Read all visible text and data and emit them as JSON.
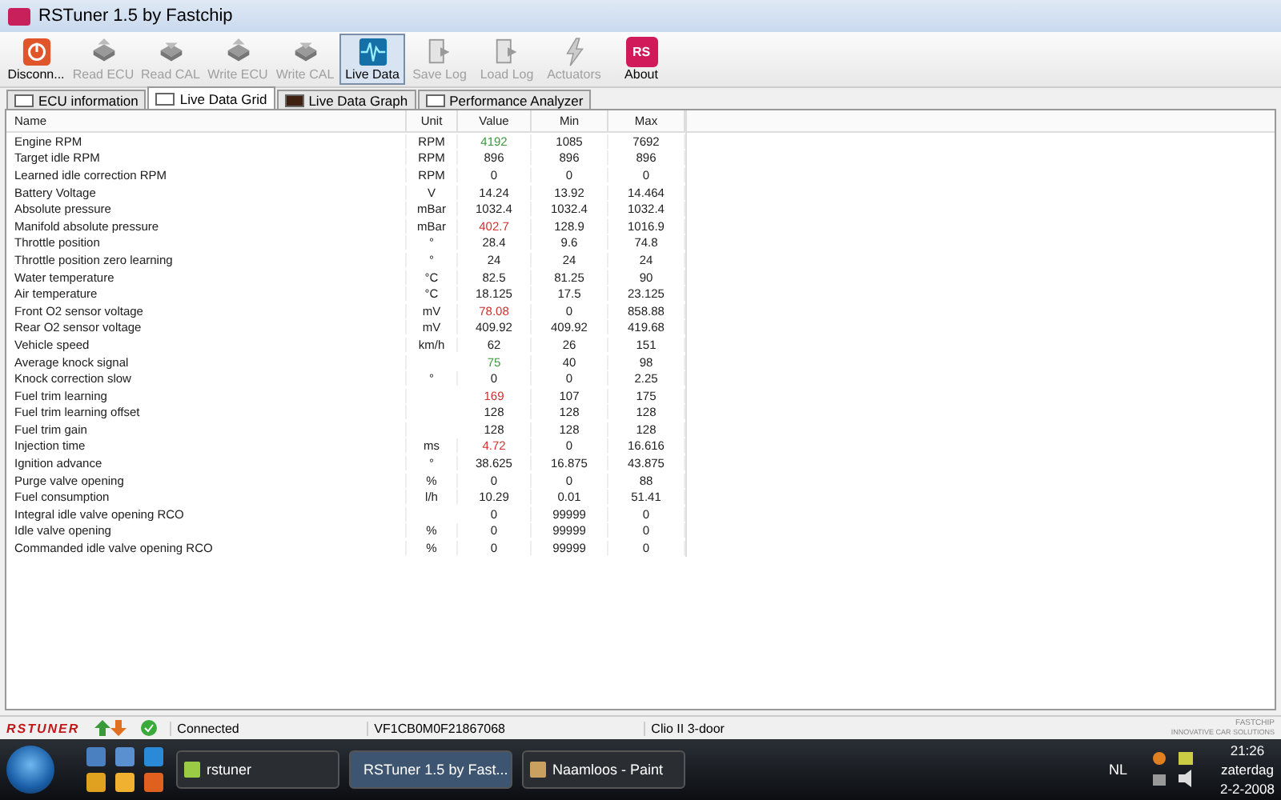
{
  "window": {
    "title": "RSTuner 1.5 by Fastchip"
  },
  "toolbar": [
    {
      "label": "Disconn...",
      "kind": "power",
      "disabled": false,
      "selected": false
    },
    {
      "label": "Read ECU",
      "kind": "chip",
      "disabled": true,
      "selected": false
    },
    {
      "label": "Read CAL",
      "kind": "chip",
      "disabled": true,
      "selected": false
    },
    {
      "label": "Write ECU",
      "kind": "chip",
      "disabled": true,
      "selected": false
    },
    {
      "label": "Write CAL",
      "kind": "chip",
      "disabled": true,
      "selected": false
    },
    {
      "label": "Live Data",
      "kind": "wave",
      "disabled": false,
      "selected": true
    },
    {
      "label": "Save Log",
      "kind": "file",
      "disabled": true,
      "selected": false
    },
    {
      "label": "Load Log",
      "kind": "file",
      "disabled": true,
      "selected": false
    },
    {
      "label": "Actuators",
      "kind": "bolt",
      "disabled": true,
      "selected": false
    },
    {
      "label": "About",
      "kind": "logo",
      "logo": "RS",
      "disabled": false,
      "selected": false
    }
  ],
  "tabs": [
    {
      "label": "ECU information",
      "selected": false
    },
    {
      "label": "Live Data Grid",
      "selected": true
    },
    {
      "label": "Live Data Graph",
      "selected": false
    },
    {
      "label": "Performance Analyzer",
      "selected": false
    }
  ],
  "grid": {
    "columns": [
      "Name",
      "Unit",
      "Value",
      "Min",
      "Max"
    ],
    "rows": [
      {
        "name": "Engine RPM",
        "unit": "RPM",
        "value": "4192",
        "min": "1085",
        "max": "7692",
        "color": "#3a9a3a"
      },
      {
        "name": "Target idle RPM",
        "unit": "RPM",
        "value": "896",
        "min": "896",
        "max": "896",
        "color": "#202020"
      },
      {
        "name": "Learned idle correction RPM",
        "unit": "RPM",
        "value": "0",
        "min": "0",
        "max": "0",
        "color": "#202020"
      },
      {
        "name": "Battery Voltage",
        "unit": "V",
        "value": "14.24",
        "min": "13.92",
        "max": "14.464",
        "color": "#202020"
      },
      {
        "name": "Absolute pressure",
        "unit": "mBar",
        "value": "1032.4",
        "min": "1032.4",
        "max": "1032.4",
        "color": "#202020"
      },
      {
        "name": "Manifold absolute pressure",
        "unit": "mBar",
        "value": "402.7",
        "min": "128.9",
        "max": "1016.9",
        "color": "#d03030"
      },
      {
        "name": "Throttle position",
        "unit": "°",
        "value": "28.4",
        "min": "9.6",
        "max": "74.8",
        "color": "#202020"
      },
      {
        "name": "Throttle position zero learning",
        "unit": "°",
        "value": "24",
        "min": "24",
        "max": "24",
        "color": "#202020"
      },
      {
        "name": "Water temperature",
        "unit": "°C",
        "value": "82.5",
        "min": "81.25",
        "max": "90",
        "color": "#202020"
      },
      {
        "name": "Air temperature",
        "unit": "°C",
        "value": "18.125",
        "min": "17.5",
        "max": "23.125",
        "color": "#202020"
      },
      {
        "name": "Front O2 sensor voltage",
        "unit": "mV",
        "value": "78.08",
        "min": "0",
        "max": "858.88",
        "color": "#d03030"
      },
      {
        "name": "Rear O2 sensor voltage",
        "unit": "mV",
        "value": "409.92",
        "min": "409.92",
        "max": "419.68",
        "color": "#202020"
      },
      {
        "name": "Vehicle speed",
        "unit": "km/h",
        "value": "62",
        "min": "26",
        "max": "151",
        "color": "#202020"
      },
      {
        "name": "Average knock signal",
        "value": "75",
        "min": "40",
        "max": "98",
        "color": "#3a9a3a"
      },
      {
        "name": "Knock correction slow",
        "unit": "°",
        "value": "0",
        "min": "0",
        "max": "2.25",
        "color": "#202020"
      },
      {
        "name": "Fuel trim learning",
        "value": "169",
        "min": "107",
        "max": "175",
        "color": "#d03030"
      },
      {
        "name": "Fuel trim learning offset",
        "value": "128",
        "min": "128",
        "max": "128",
        "color": "#202020"
      },
      {
        "name": "Fuel trim gain",
        "value": "128",
        "min": "128",
        "max": "128",
        "color": "#202020"
      },
      {
        "name": "Injection time",
        "unit": "ms",
        "value": "4.72",
        "min": "0",
        "max": "16.616",
        "color": "#d03030"
      },
      {
        "name": "Ignition advance",
        "unit": "°",
        "value": "38.625",
        "min": "16.875",
        "max": "43.875",
        "color": "#202020"
      },
      {
        "name": "Purge valve opening",
        "unit": "%",
        "value": "0",
        "min": "0",
        "max": "88",
        "color": "#202020"
      },
      {
        "name": "Fuel consumption",
        "unit": "l/h",
        "value": "10.29",
        "min": "0.01",
        "max": "51.41",
        "color": "#202020"
      },
      {
        "name": "Integral idle valve opening RCO",
        "value": "0",
        "min": "99999",
        "max": "0",
        "color": "#202020"
      },
      {
        "name": "Idle valve opening",
        "unit": "%",
        "value": "0",
        "min": "99999",
        "max": "0",
        "color": "#202020"
      },
      {
        "name": "Commanded idle valve opening RCO",
        "unit": "%",
        "value": "0",
        "min": "99999",
        "max": "0",
        "color": "#202020"
      }
    ]
  },
  "status_bar": {
    "brand": "RSTUNER",
    "connection": "Connected",
    "vin": "VF1CB0M0F21867068",
    "vehicle": "Clio II 3-door",
    "vendor": "FASTCHIP",
    "vendor_tagline": "INNOVATIVE CAR SOLUTIONS"
  },
  "taskbar": {
    "tasks": [
      {
        "label": "rstuner",
        "selected": false
      },
      {
        "label": "RSTuner 1.5 by Fast...",
        "selected": true
      },
      {
        "label": "Naamloos - Paint",
        "selected": false
      }
    ],
    "language": "NL",
    "time": "21:26",
    "day": "zaterdag",
    "date": "2-2-2008"
  }
}
